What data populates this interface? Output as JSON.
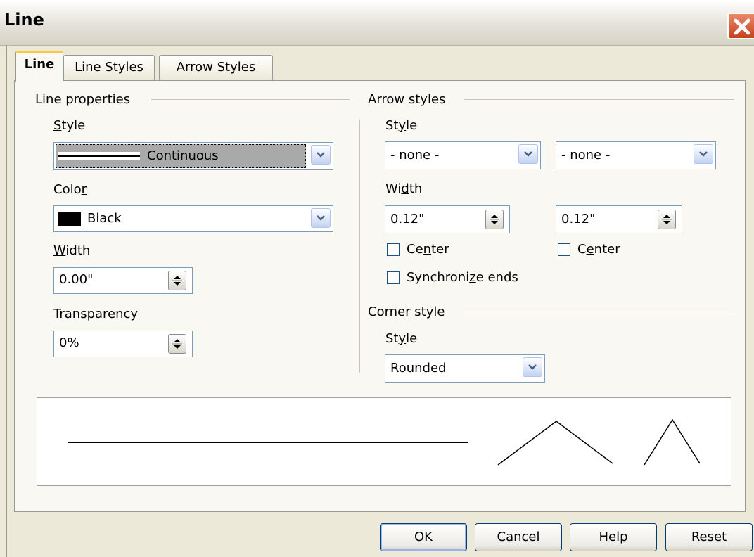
{
  "window": {
    "title": "Line"
  },
  "tabs": [
    {
      "label": "Line",
      "active": true
    },
    {
      "label": "Line Styles",
      "active": false
    },
    {
      "label": "Arrow Styles",
      "active": false
    }
  ],
  "line_properties": {
    "title": "Line properties",
    "style_label": "Style",
    "style_value": "Continuous",
    "color_label": "Color",
    "color_value": "Black",
    "color_swatch": "#000000",
    "width_label": "Width",
    "width_value": "0.00\"",
    "transparency_label": "Transparency",
    "transparency_value": "0%"
  },
  "arrow_styles": {
    "title": "Arrow styles",
    "style_label": "Style",
    "start_style": "- none -",
    "end_style": "- none -",
    "width_label": "Width",
    "start_width": "0.12\"",
    "end_width": "0.12\"",
    "start_center_label": "Center",
    "end_center_label": "Center",
    "start_center_checked": false,
    "end_center_checked": false,
    "sync_label": "Synchronize ends",
    "sync_checked": false
  },
  "corner_style": {
    "title": "Corner style",
    "style_label": "Style",
    "style_value": "Rounded"
  },
  "buttons": {
    "ok": "OK",
    "cancel": "Cancel",
    "help": "Help",
    "reset": "Reset"
  },
  "colors": {
    "accent_tab": "#ffc83c",
    "close_button": "#c8401d",
    "selection_highlight": "#a9a9a9"
  }
}
